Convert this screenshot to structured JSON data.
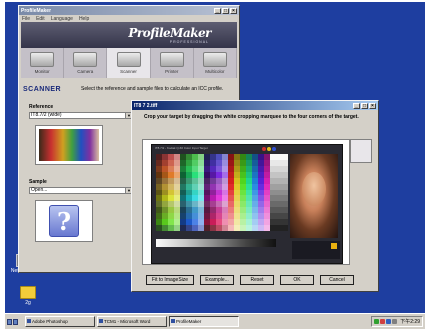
{
  "desktop": {
    "icons": [
      {
        "label": "Net College"
      },
      {
        "label": "2g"
      }
    ]
  },
  "profilemaker": {
    "title": "ProfileMaker",
    "menu": [
      "File",
      "Edit",
      "Language",
      "Help"
    ],
    "brand": {
      "logo": "ProfileMaker",
      "sub": "PROFESSIONAL"
    },
    "tabs": [
      {
        "label": "Monitor",
        "icon": "monitor-icon"
      },
      {
        "label": "Camera",
        "icon": "camera-icon"
      },
      {
        "label": "Scanner",
        "icon": "scanner-icon"
      },
      {
        "label": "Printer",
        "icon": "printer-icon"
      },
      {
        "label": "Multicolor",
        "icon": "multicolor-icon"
      }
    ],
    "mode_title": "SCANNER",
    "mode_text": "Select the reference and sample files to calculate an ICC profile.",
    "reference": {
      "label": "Reference",
      "value": "IT8.7/2 (wide)"
    },
    "sample": {
      "label": "Sample",
      "value": "Open..."
    }
  },
  "dialog": {
    "title": "IT8 7 2.tiff",
    "instruction": "Crop your target by dragging the white cropping marquee to the four corners of the target.",
    "target_header": "IT8.7/2 - Kodak Q-60 Color Input Target",
    "buttons": {
      "fit": "Fit to ImageSize",
      "example": "Example...",
      "reset": "Reset",
      "ok": "OK",
      "cancel": "Cancel"
    }
  },
  "taskbar": {
    "tasks": [
      {
        "label": "Adobe Photoshop"
      },
      {
        "label": "TCM1 - Microsoft Word"
      },
      {
        "label": "ProfileMaker"
      }
    ],
    "clock": "下午2:29"
  },
  "colors": {
    "desktop": "#1e3ea0",
    "titlebar_active": "#0a246a",
    "window_face": "#d4d0c8"
  }
}
